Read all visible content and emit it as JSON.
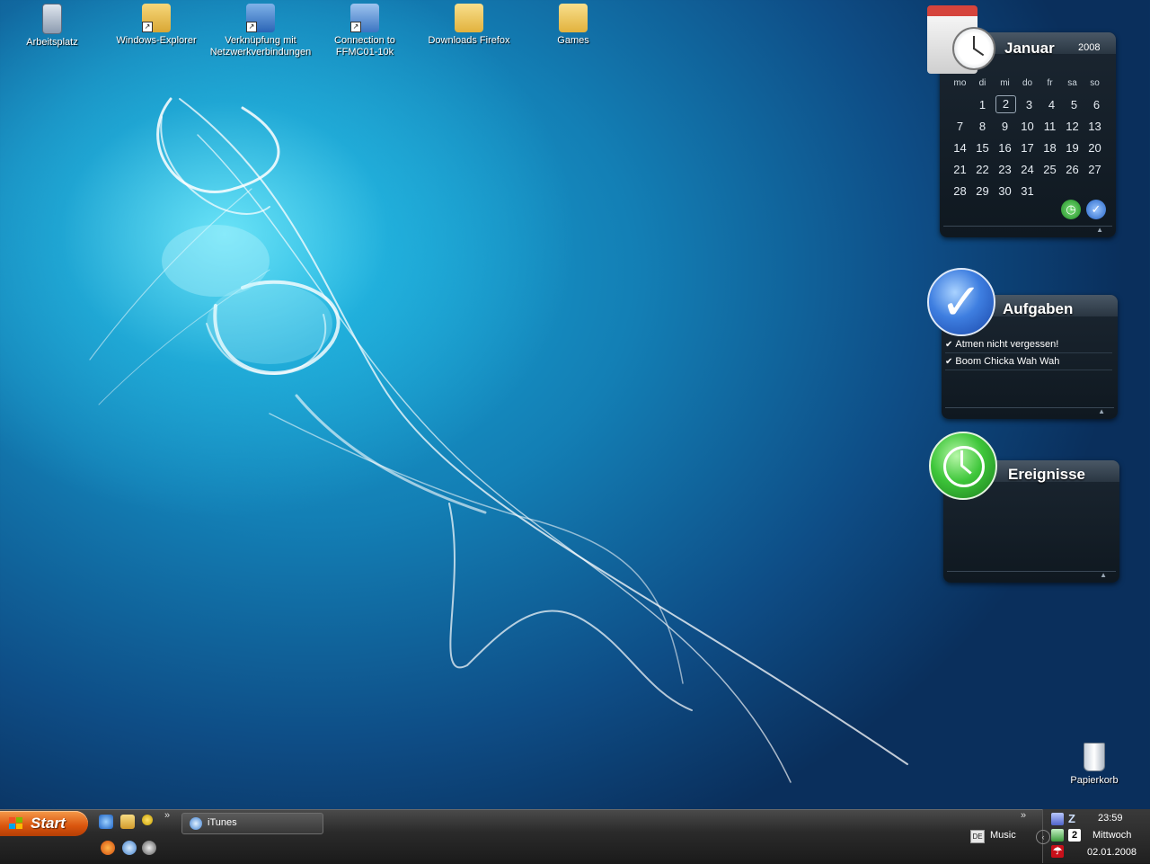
{
  "desktop": {
    "icons": [
      {
        "label": "Arbeitsplatz",
        "icon": "computer-icon"
      },
      {
        "label": "Windows-Explorer",
        "icon": "explorer-icon"
      },
      {
        "label": "Verknüpfung mit Netzwerkverbindungen",
        "icon": "network-connections-icon"
      },
      {
        "label": "Connection to FFMC01-10k",
        "icon": "connection-icon"
      },
      {
        "label": "Downloads Firefox",
        "icon": "folder-icon"
      },
      {
        "label": "Games",
        "icon": "folder-star-icon"
      }
    ],
    "recycle_bin": {
      "label": "Papierkorb"
    }
  },
  "calendar_gadget": {
    "month": "Januar",
    "year": "2008",
    "weekdays": [
      "mo",
      "di",
      "mi",
      "do",
      "fr",
      "sa",
      "so"
    ],
    "weeks": [
      [
        "",
        "1",
        "2",
        "3",
        "4",
        "5",
        "6"
      ],
      [
        "7",
        "8",
        "9",
        "10",
        "11",
        "12",
        "13"
      ],
      [
        "14",
        "15",
        "16",
        "17",
        "18",
        "19",
        "20"
      ],
      [
        "21",
        "22",
        "23",
        "24",
        "25",
        "26",
        "27"
      ],
      [
        "28",
        "29",
        "30",
        "31",
        "",
        "",
        ""
      ]
    ],
    "today": "2"
  },
  "tasks_gadget": {
    "title": "Aufgaben",
    "items": [
      "Atmen nicht vergessen!",
      "Boom Chicka Wah Wah"
    ]
  },
  "events_gadget": {
    "title": "Ereignisse"
  },
  "taskbar": {
    "start_label": "Start",
    "quick_launch": [
      "internet-explorer-icon",
      "windows-explorer-icon",
      "network-icon",
      "firefox-icon",
      "itunes-icon",
      "steam-icon"
    ],
    "open_windows": [
      {
        "label": "iTunes",
        "icon": "itunes-icon"
      }
    ],
    "language": "DE",
    "toolbar_label": "Music",
    "clock": {
      "time": "23:59",
      "day": "Mittwoch",
      "date": "02.01.2008"
    },
    "tray_badge": "2"
  },
  "colors": {
    "start_button": "#d9550e",
    "taskbar": "#2b2b2b",
    "gadget_bg": "#1b2631",
    "wallpaper_accent": "#1aa6d6"
  }
}
